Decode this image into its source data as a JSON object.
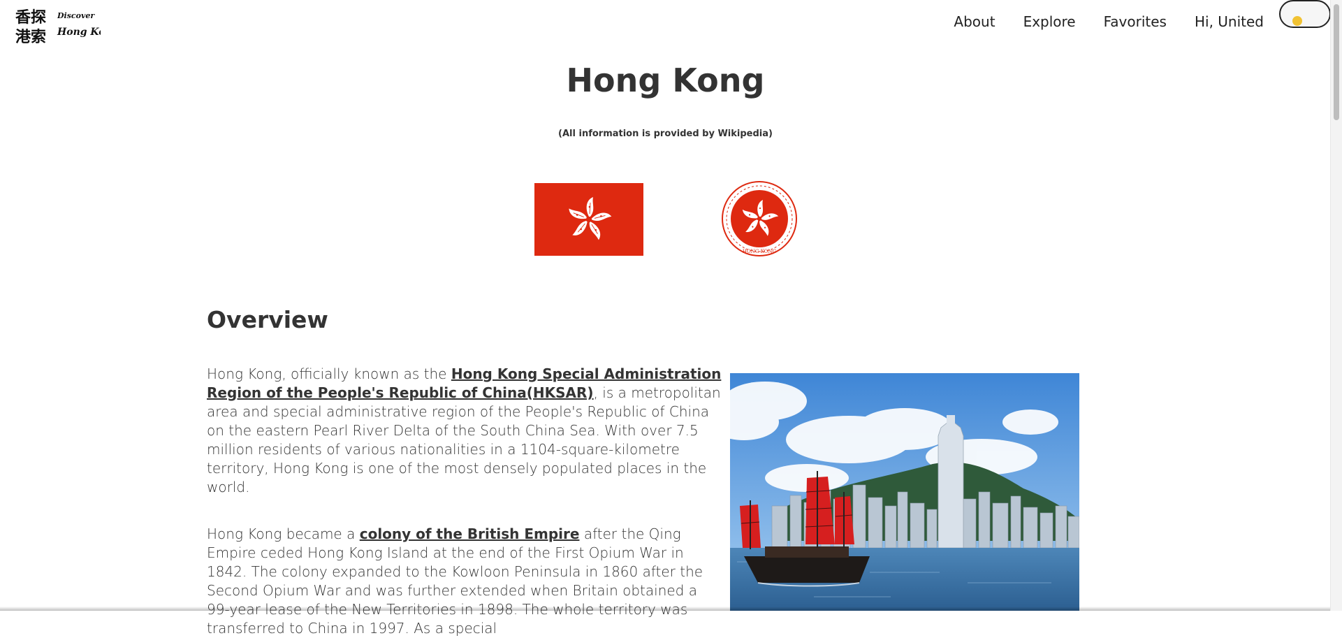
{
  "header": {
    "logo": {
      "chinese_top": "香探",
      "chinese_bottom": "港索",
      "english_top": "Discover",
      "english_bottom": "Hong Kong"
    },
    "nav": [
      {
        "label": "About"
      },
      {
        "label": "Explore"
      },
      {
        "label": "Favorites"
      },
      {
        "label": "Hi, United"
      }
    ],
    "theme_toggle": {
      "knob_color": "#f1c232"
    }
  },
  "main": {
    "title": "Hong Kong",
    "source_note": "(All information is provided by Wikipedia)",
    "flag": {
      "icon": "bauhinia-flag-icon",
      "color": "#de2910"
    },
    "emblem": {
      "icon": "bauhinia-emblem-icon",
      "caption": "HONG KONG"
    },
    "overview": {
      "heading": "Overview",
      "p1": {
        "before": "Hong Kong, officially known as the ",
        "link": "Hong Kong Special Administration Region of the People's Republic of China(HKSAR)",
        "after": ", is a metropolitan area and special administrative region of the People's Republic of China on the eastern Pearl River Delta of the South China Sea. With over 7.5 million residents of various nationalities in a 1104-square-kilometre territory, Hong Kong is one of the most densely populated places in the world."
      },
      "p2": {
        "before": "Hong Kong became a ",
        "link": "colony of the British Empire",
        "after": " after the Qing Empire ceded Hong Kong Island at the end of the First Opium War in 1842. The colony expanded to the Kowloon Peninsula in 1860 after the Second Opium War and was further extended when Britain obtained a 99-year lease of the New Territories in 1898. The whole territory was transferred to China in 1997. As a special"
      }
    }
  }
}
